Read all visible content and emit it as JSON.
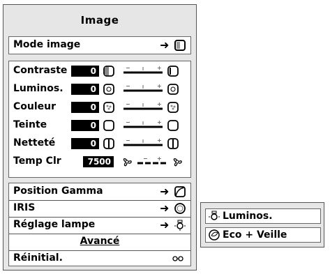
{
  "menu": {
    "title": "Image",
    "mode_label": "Mode image",
    "adjust": [
      {
        "label": "Contraste",
        "value": "0",
        "icon": "contrast-icon"
      },
      {
        "label": "Luminos.",
        "value": "0",
        "icon": "brightness-icon"
      },
      {
        "label": "Couleur",
        "value": "0",
        "icon": "color-icon"
      },
      {
        "label": "Teinte",
        "value": "0",
        "icon": "tint-icon"
      },
      {
        "label": "Netteté",
        "value": "0",
        "icon": "sharpness-icon"
      }
    ],
    "temp": {
      "label": "Temp Clr",
      "value": "7500",
      "icon": "fan-icon"
    },
    "gamma_label": "Position Gamma",
    "iris_label": "IRIS",
    "lamp_label": "Réglage lampe",
    "advanced_label": "Avancé",
    "reset_label": "Réinitial.",
    "slider_marks": {
      "minus": "−",
      "plus": "+"
    }
  },
  "lamp_options": [
    {
      "label": "Luminos.",
      "icon": "lamp-icon"
    },
    {
      "label": "Eco + Veille",
      "icon": "eco-icon"
    }
  ]
}
